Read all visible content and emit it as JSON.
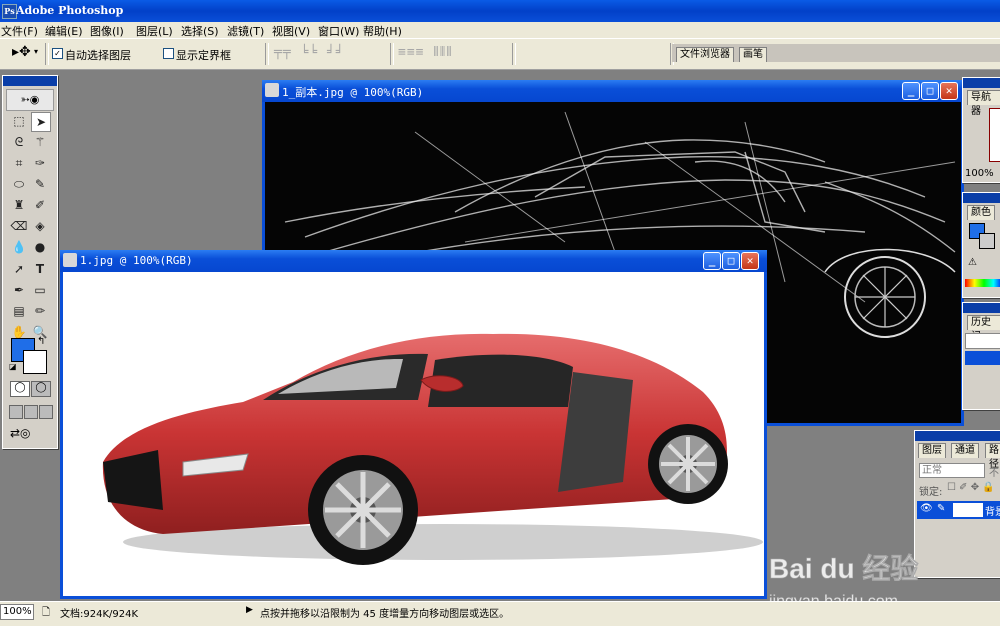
{
  "app": {
    "title": "Adobe Photoshop",
    "icon": "photoshop-icon"
  },
  "menu": [
    "文件(F)",
    "编辑(E)",
    "图像(I)",
    "图层(L)",
    "选择(S)",
    "滤镜(T)",
    "视图(V)",
    "窗口(W)",
    "帮助(H)"
  ],
  "options": {
    "auto_select_label": "自动选择图层",
    "auto_select_checked": true,
    "show_bounds_label": "显示定界框",
    "show_bounds_checked": false
  },
  "palette_well": {
    "tabs": [
      "文件浏览器",
      "画笔"
    ]
  },
  "windows": [
    {
      "title": "1_副本.jpg @ 100%(RGB)"
    },
    {
      "title": "1.jpg @ 100%(RGB)"
    }
  ],
  "panels": {
    "navigator": {
      "tab": "导航器",
      "zoom": "100%"
    },
    "color": {
      "tab": "颜色"
    },
    "history": {
      "tab": "历史记"
    },
    "layers": {
      "tabs": [
        "图层",
        "通道",
        "路径"
      ],
      "blend_mode": "正常",
      "opacity_label": "不",
      "lock_label": "锁定:",
      "layer_name": "背景"
    }
  },
  "colors": {
    "foreground": "#1f6ee8",
    "background": "#ffffff",
    "titlebar": "#0a4fd8",
    "chrome": "#ece9d8"
  },
  "status": {
    "zoom": "100%",
    "doc_info": "文档:924K/924K",
    "hint": "点按并拖移以沿限制为 45 度增量方向移动图层或选区。"
  },
  "watermark": {
    "brand": "Bai du 经验",
    "url": "jingyan.baidu.com"
  }
}
